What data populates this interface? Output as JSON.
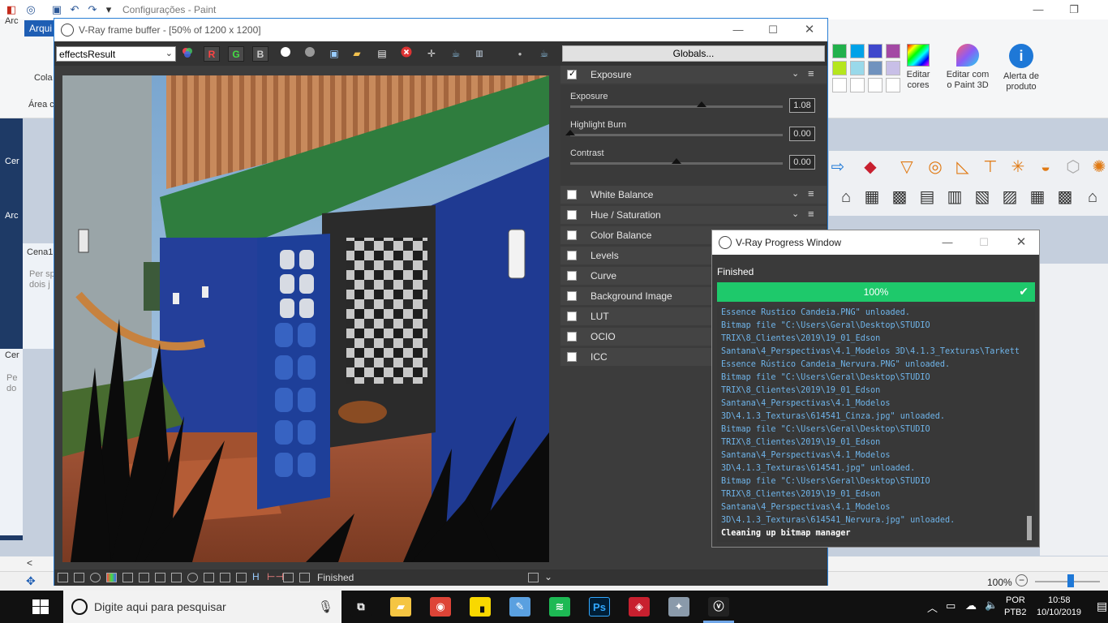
{
  "paint": {
    "title": "Configurações - Paint",
    "file_tab": "Arqui",
    "clipboard_label": "Cola",
    "area_label": "Área c",
    "edit_colors": "Editar cores",
    "edit_paint3d": "Editar com o Paint 3D",
    "product_alert": "Alerta de produto",
    "zoom": "100%",
    "left_fragments": [
      "Arc",
      "Cer",
      "Arc",
      "Cena1",
      "Per sp",
      "dois j",
      "Cer",
      "Pe",
      "do"
    ]
  },
  "vfb": {
    "title": "V-Ray frame buffer - [50% of 1200 x 1200]",
    "channel": "effectsResult",
    "rgb_buttons": [
      "R",
      "G",
      "B"
    ],
    "globals_label": "Globals...",
    "status": "Finished",
    "exposure": {
      "label": "Exposure",
      "sliders": [
        {
          "label": "Exposure",
          "value": "1.08",
          "level": 0.62
        },
        {
          "label": "Highlight Burn",
          "value": "0.00",
          "level": 0.0
        },
        {
          "label": "Contrast",
          "value": "0.00",
          "level": 0.5
        }
      ]
    },
    "layers": [
      "White Balance",
      "Hue / Saturation",
      "Color Balance",
      "Levels",
      "Curve",
      "Background Image",
      "LUT",
      "OCIO",
      "ICC"
    ]
  },
  "progress": {
    "title": "V-Ray Progress Window",
    "status": "Finished",
    "percent": "100%",
    "progress_level": 1.0,
    "log": [
      "Essence Rustico Candeia.PNG\" unloaded.",
      "Bitmap file \"C:\\Users\\Geral\\Desktop\\STUDIO",
      "TRIX\\8_Clientes\\2019\\19_01_Edson",
      "Santana\\4_Perspectivas\\4.1_Modelos 3D\\4.1.3_Texturas\\Tarkett",
      "Essence Rústico Candeia_Nervura.PNG\" unloaded.",
      "Bitmap file \"C:\\Users\\Geral\\Desktop\\STUDIO",
      "TRIX\\8_Clientes\\2019\\19_01_Edson",
      "Santana\\4_Perspectivas\\4.1_Modelos",
      "3D\\4.1.3_Texturas\\614541_Cinza.jpg\" unloaded.",
      "Bitmap file \"C:\\Users\\Geral\\Desktop\\STUDIO",
      "TRIX\\8_Clientes\\2019\\19_01_Edson",
      "Santana\\4_Perspectivas\\4.1_Modelos",
      "3D\\4.1.3_Texturas\\614541.jpg\" unloaded.",
      "Bitmap file \"C:\\Users\\Geral\\Desktop\\STUDIO",
      "TRIX\\8_Clientes\\2019\\19_01_Edson",
      "Santana\\4_Perspectivas\\4.1_Modelos",
      "3D\\4.1.3_Texturas\\614541_Nervura.jpg\" unloaded.",
      "Cleaning up bitmap manager"
    ]
  },
  "taskbar": {
    "search_placeholder": "Digite aqui para pesquisar",
    "lang_top": "POR",
    "lang_bottom": "PTB2",
    "time": "10:58",
    "date": "10/10/2019",
    "apps": [
      {
        "icon": "task-view-icon",
        "color": "#111111"
      },
      {
        "icon": "file-explorer-icon",
        "color": "#f5c542"
      },
      {
        "icon": "chrome-icon",
        "color": "#de4437"
      },
      {
        "icon": "sticky-notes-icon",
        "color": "#f9d800"
      },
      {
        "icon": "paint-icon",
        "color": "#5aa0e0"
      },
      {
        "icon": "spotify-icon",
        "color": "#1db954"
      },
      {
        "icon": "photoshop-icon",
        "color": "#001e36"
      },
      {
        "icon": "sketchup-icon",
        "color": "#c8202f"
      },
      {
        "icon": "paint-palette-icon",
        "color": "#8a9aaa"
      },
      {
        "icon": "vray-icon",
        "color": "#222222"
      }
    ]
  },
  "colors": {
    "accent_green": "#1ec96b",
    "log_blue": "#6fb4e9",
    "vfb_bg": "#3c3c3c"
  }
}
